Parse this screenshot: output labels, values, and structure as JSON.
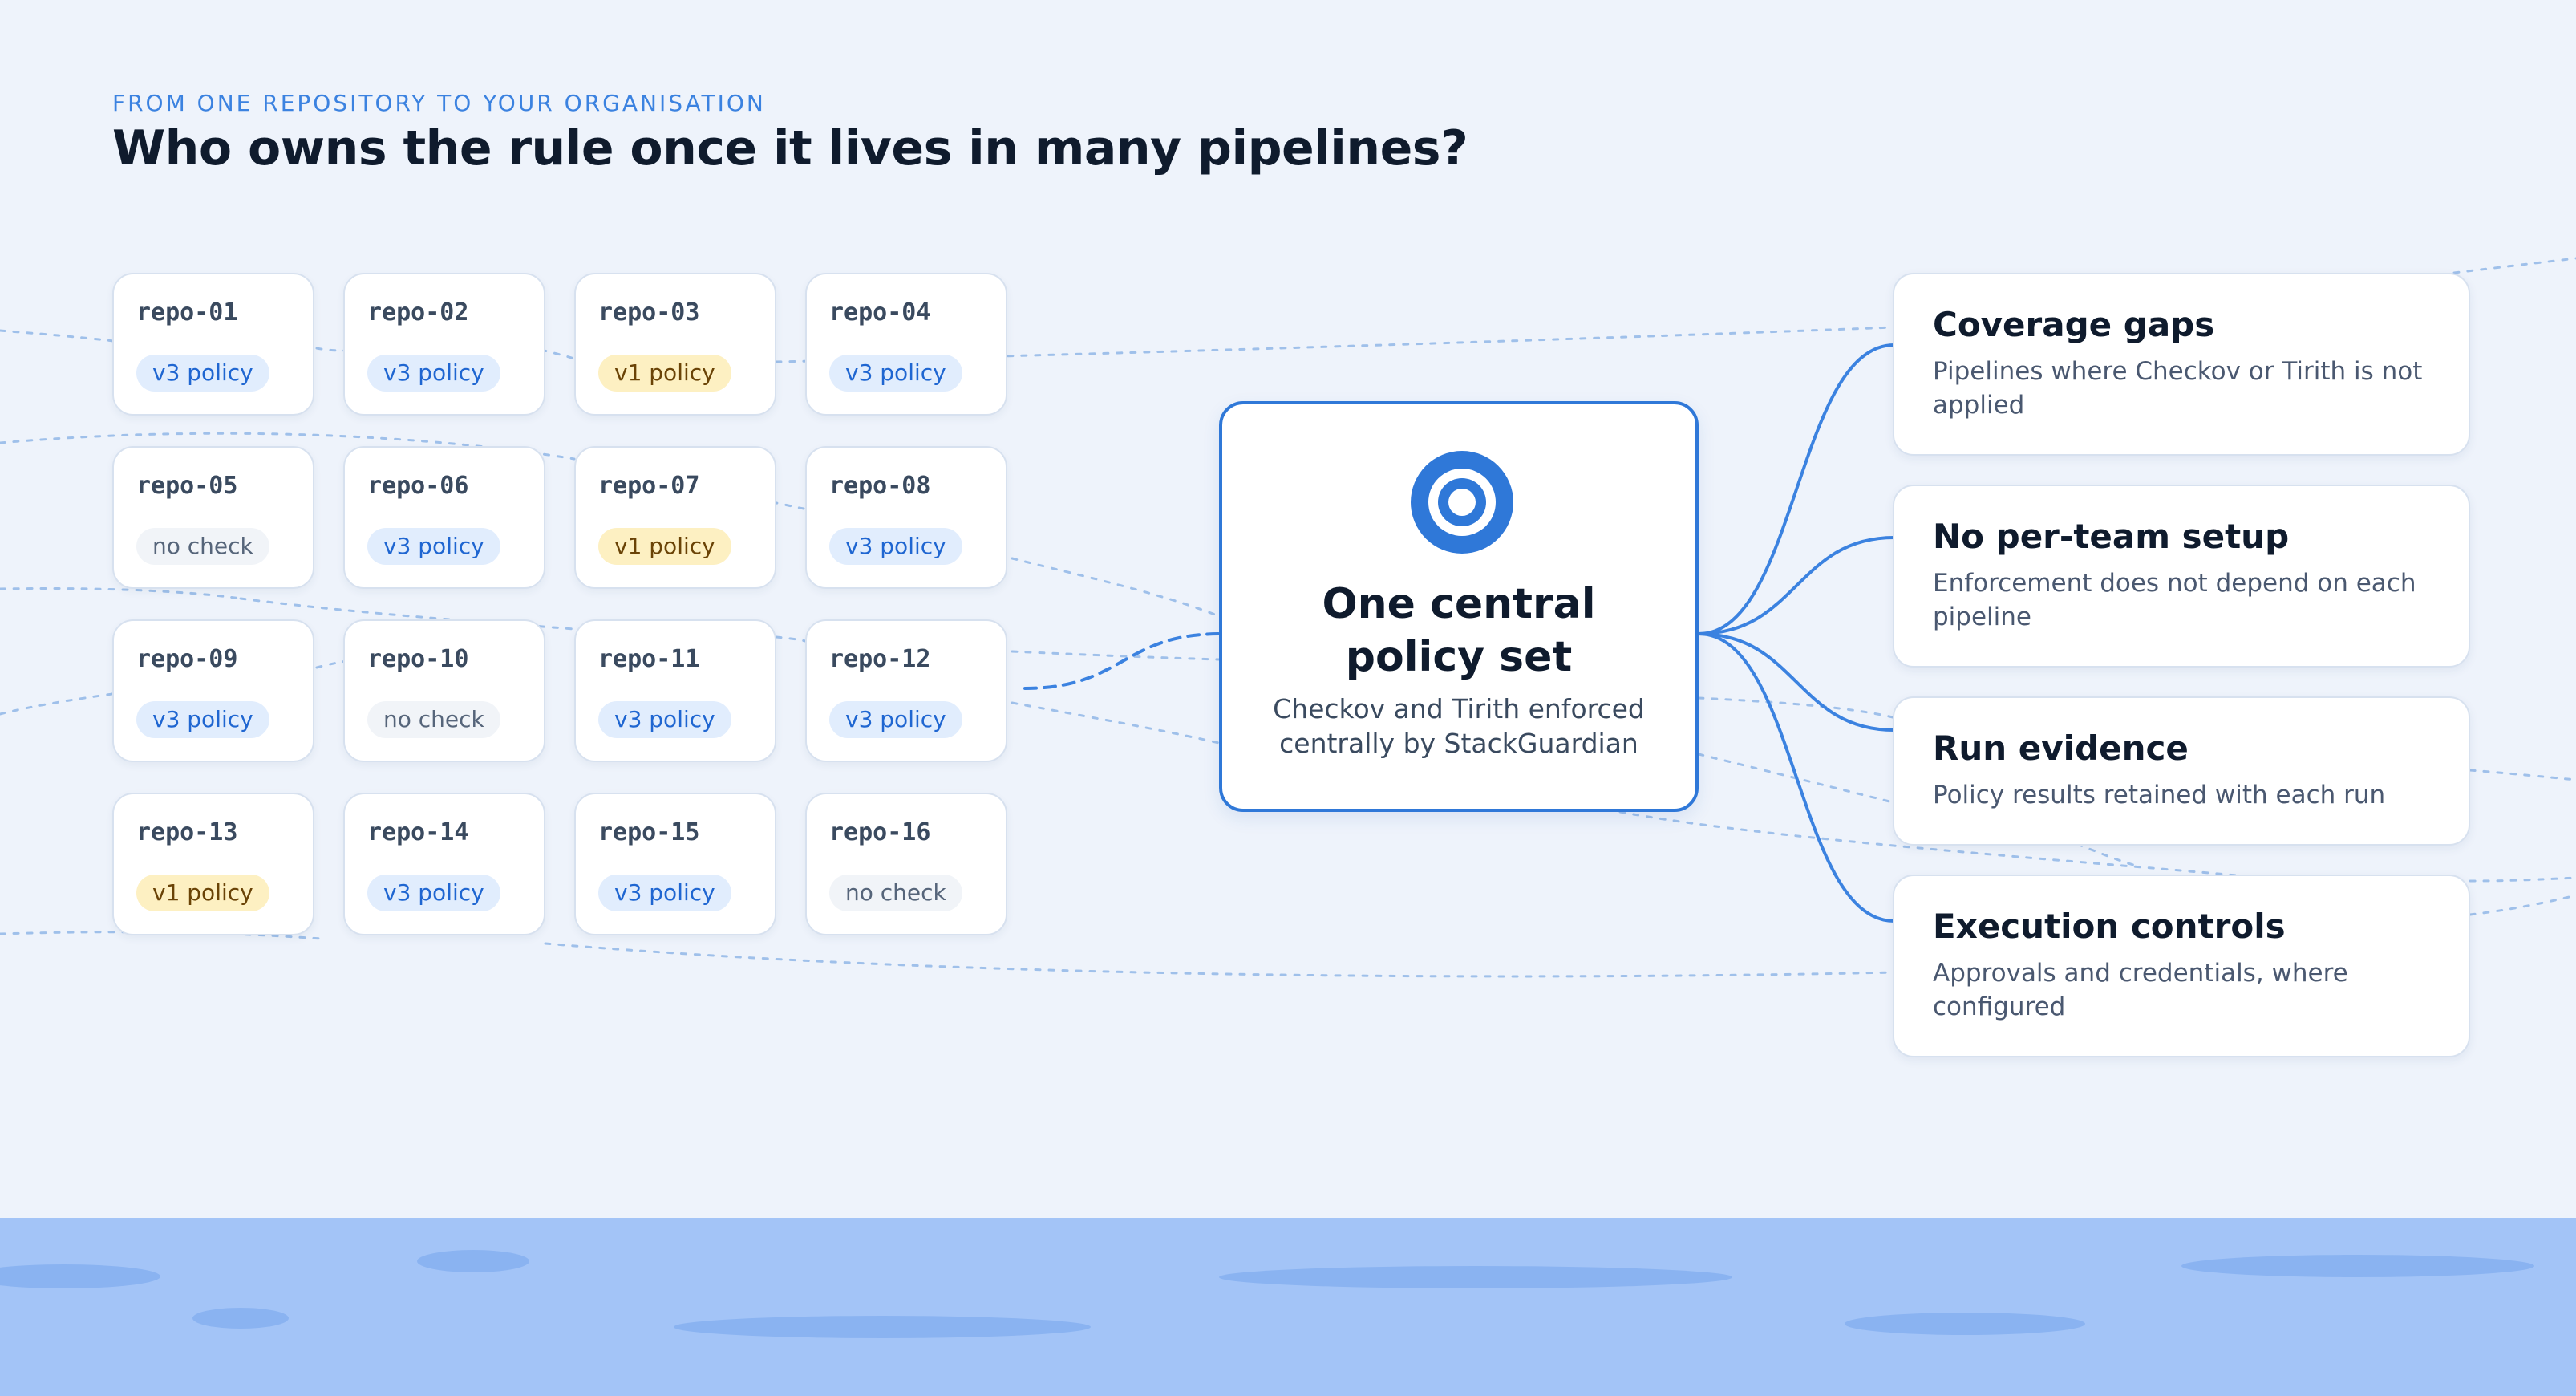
{
  "header": {
    "eyebrow": "FROM ONE REPOSITORY TO YOUR ORGANISATION",
    "title": "Who owns the rule once it lives in many pipelines?"
  },
  "repos": [
    {
      "name": "repo-01",
      "policy": "v3 policy",
      "kind": "v3"
    },
    {
      "name": "repo-02",
      "policy": "v3 policy",
      "kind": "v3"
    },
    {
      "name": "repo-03",
      "policy": "v1 policy",
      "kind": "v1"
    },
    {
      "name": "repo-04",
      "policy": "v3 policy",
      "kind": "v3"
    },
    {
      "name": "repo-05",
      "policy": "no check",
      "kind": "none"
    },
    {
      "name": "repo-06",
      "policy": "v3 policy",
      "kind": "v3"
    },
    {
      "name": "repo-07",
      "policy": "v1 policy",
      "kind": "v1"
    },
    {
      "name": "repo-08",
      "policy": "v3 policy",
      "kind": "v3"
    },
    {
      "name": "repo-09",
      "policy": "v3 policy",
      "kind": "v3"
    },
    {
      "name": "repo-10",
      "policy": "no check",
      "kind": "none"
    },
    {
      "name": "repo-11",
      "policy": "v3 policy",
      "kind": "v3"
    },
    {
      "name": "repo-12",
      "policy": "v3 policy",
      "kind": "v3"
    },
    {
      "name": "repo-13",
      "policy": "v1 policy",
      "kind": "v1"
    },
    {
      "name": "repo-14",
      "policy": "v3 policy",
      "kind": "v3"
    },
    {
      "name": "repo-15",
      "policy": "v3 policy",
      "kind": "v3"
    },
    {
      "name": "repo-16",
      "policy": "no check",
      "kind": "none"
    }
  ],
  "hub": {
    "icon": "target-icon",
    "title": "One central policy set",
    "subtitle": "Checkov and Tirith enforced centrally by StackGuardian"
  },
  "outcomes": [
    {
      "title": "Coverage gaps",
      "description": "Pipelines where Checkov or Tirith is not applied"
    },
    {
      "title": "No per-team setup",
      "description": "Enforcement does not depend on each pipeline"
    },
    {
      "title": "Run evidence",
      "description": "Policy results retained with each run"
    },
    {
      "title": "Execution controls",
      "description": "Approvals and credentials, where configured"
    }
  ],
  "colors": {
    "accent": "#2f78d8",
    "connector": "#3b82e0",
    "dotted_line": "#9fc0ea",
    "v3_badge": "#e1edfd",
    "v1_badge": "#fdf0c2",
    "no_check_badge": "#f1f4f8"
  }
}
